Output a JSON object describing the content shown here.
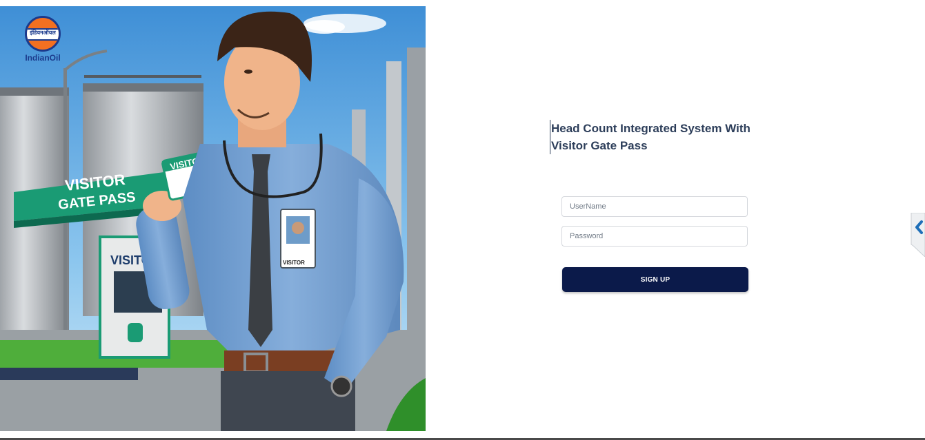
{
  "brand": {
    "logo_text": "इंडियनऑयल",
    "name": "IndianOil"
  },
  "illustration": {
    "sign_line1": "VISITOR",
    "sign_line2": "GATE PASS",
    "booth_sign": "VISITOR",
    "card_text": "VISITOR",
    "badge_text": "VISITOR"
  },
  "login": {
    "title": "Head Count Integrated System With Visitor Gate Pass",
    "username_placeholder": "UserName",
    "password_placeholder": "Password",
    "signup_label": "SIGN UP"
  },
  "side_tab": {
    "icon": "chevron-left-icon"
  },
  "colors": {
    "button": "#0b1a4a",
    "title": "#2d3e5a",
    "accent_green": "#1aa37a",
    "brand_orange": "#f37021",
    "brand_blue": "#1b3a8c"
  }
}
